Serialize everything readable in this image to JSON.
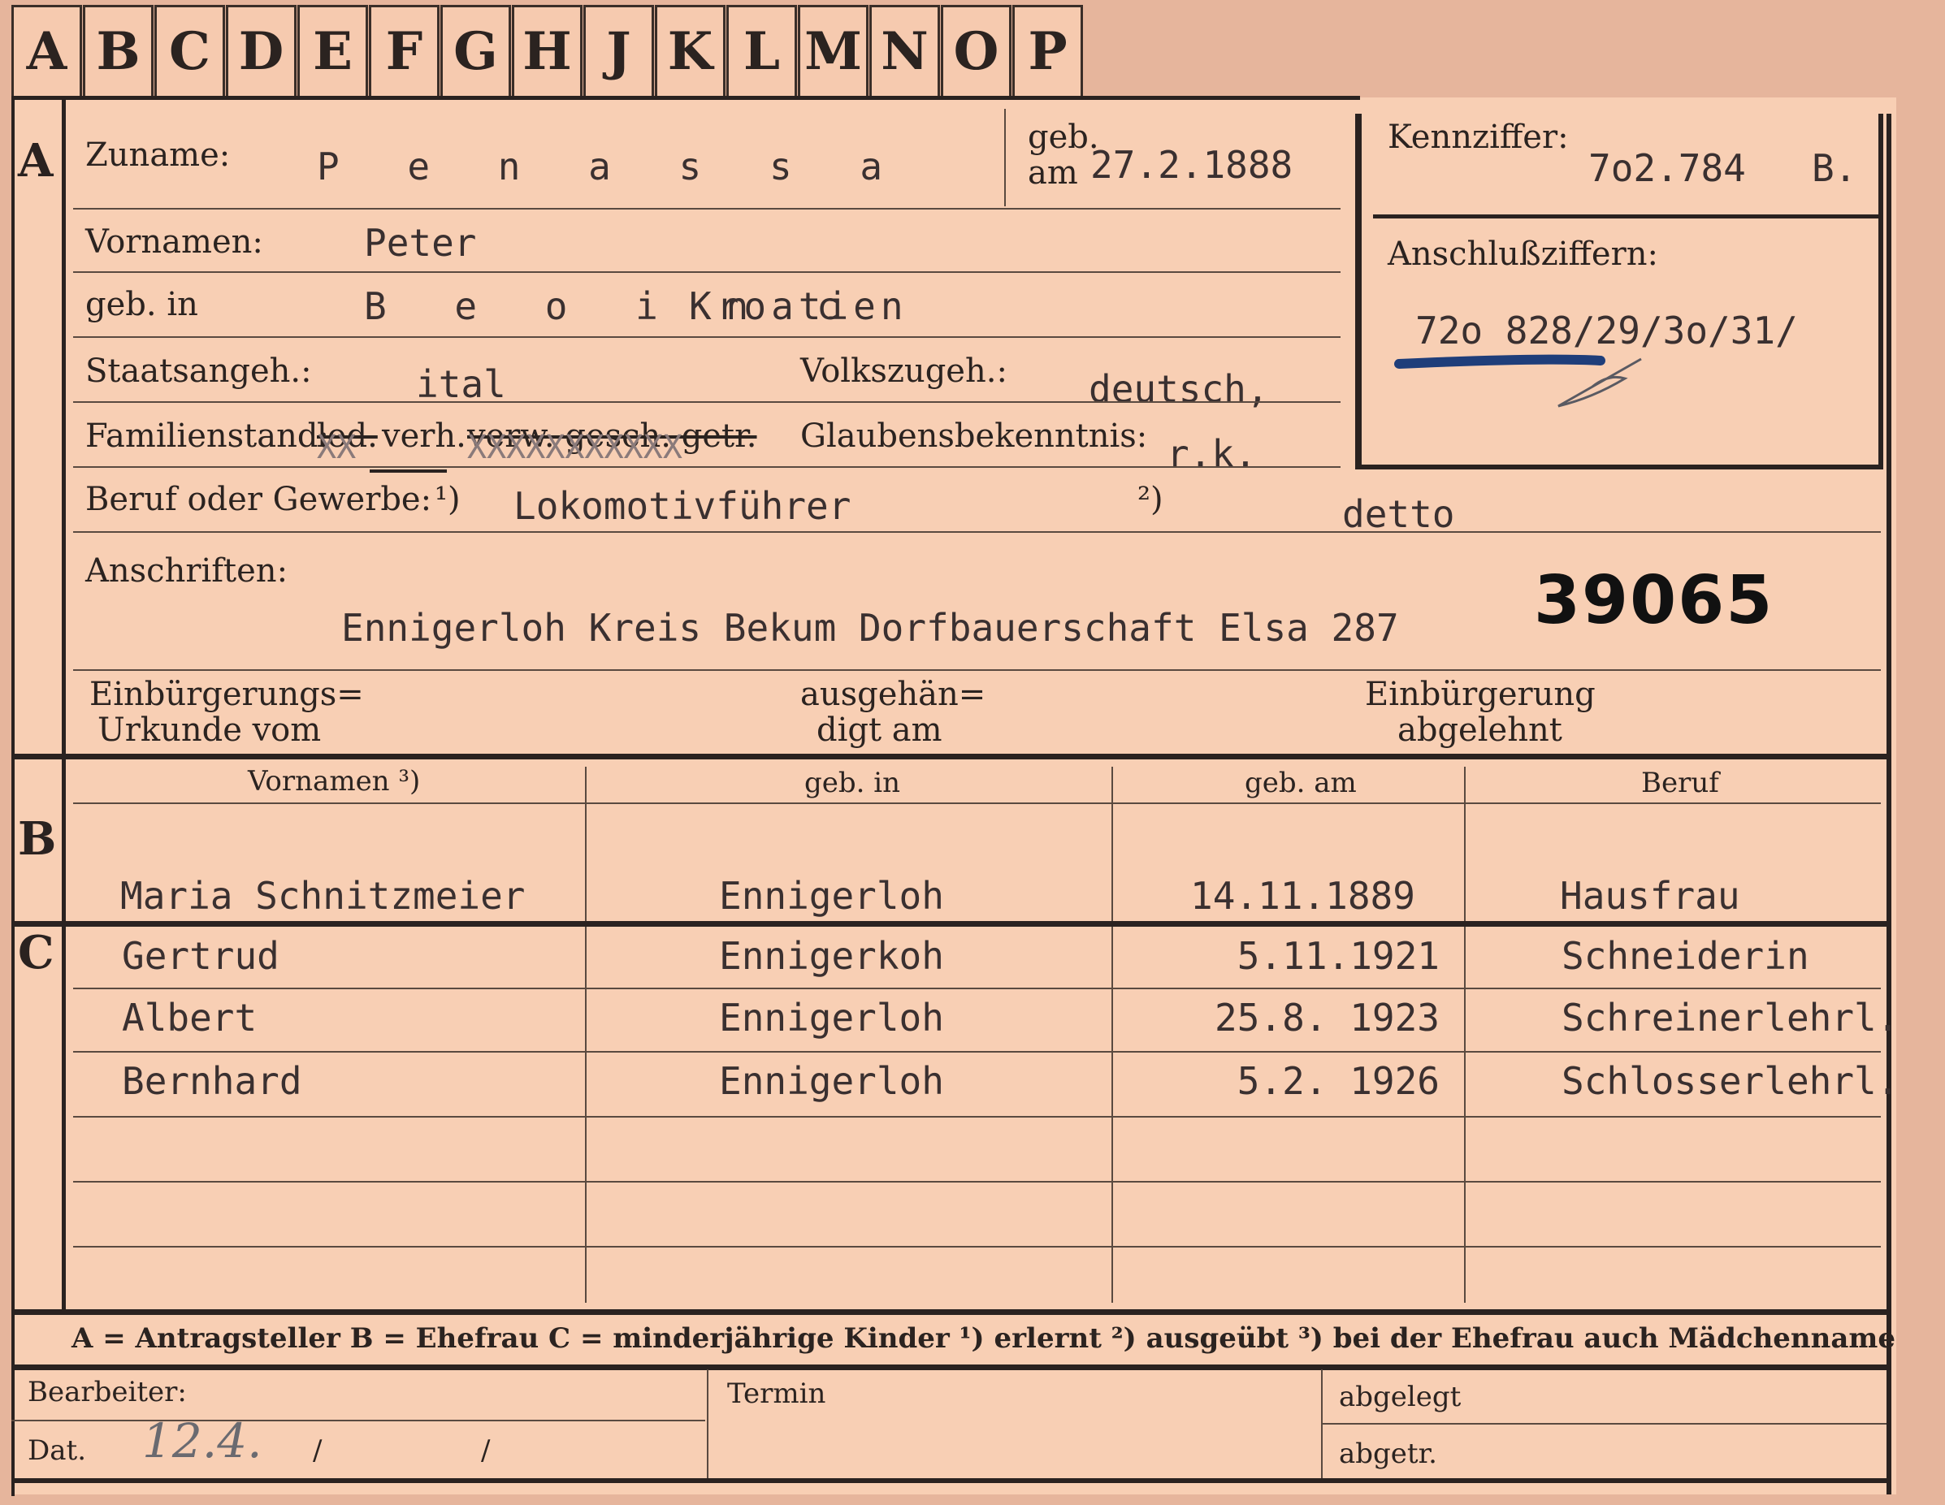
{
  "tabs": [
    "A",
    "B",
    "C",
    "D",
    "E",
    "F",
    "G",
    "H",
    "J",
    "K",
    "L",
    "M",
    "N",
    "O",
    "P"
  ],
  "section_a": {
    "marker": "A",
    "surname_label": "Zuname:",
    "surname": "P e n a s s a",
    "born_on_label_1": "geb.",
    "born_on_label_2": "am",
    "born_on": "27.2.1888",
    "given_names_label": "Vornamen:",
    "given_names": "Peter",
    "born_in_label": "geb. in",
    "born_in_place": "B e o i n c",
    "born_in_country": "Kroatien",
    "citizenship_label": "Staatsangeh.:",
    "citizenship": "ital",
    "ethnicity_label": "Volkszugeh.:",
    "ethnicity": "deutsch,",
    "marital_label": "Familienstand:",
    "marital_led": "led.",
    "marital_verh": "verh.",
    "marital_rest": "verw. gesch. getr.",
    "marital_xs": "XX",
    "marital_xs2": "XXXXXXXXXXX",
    "religion_label": "Glaubensbekenntnis:",
    "religion": "r.k.",
    "occupation_label": "Beruf oder Gewerbe:",
    "occupation_mark_1": "¹)",
    "occupation_learned": "Lokomotivführer",
    "occupation_mark_2": "²)",
    "occupation_practiced": "detto",
    "address_label": "Anschriften:",
    "address": "Ennigerloh Kreis Bekum Dorfbauerschaft Elsa 287",
    "stamp_number": "39065",
    "naturalization_label_1": "Einbürgerungs=",
    "naturalization_label_2": "Urkunde vom",
    "handed_label_1": "ausgehän=",
    "handed_label_2": "digt am",
    "rejected_label_1": "Einbürgerung",
    "rejected_label_2": "abgelehnt"
  },
  "id_box": {
    "code_label": "Kennziffer:",
    "code": "7o2.784",
    "code_suffix": "B.",
    "connection_label": "Anschlußziffern:",
    "connection": "72o 828/29/3o/31/"
  },
  "columns": {
    "given_names": "Vornamen ³)",
    "born_in": "geb. in",
    "born_on": "geb. am",
    "occupation": "Beruf"
  },
  "section_b": {
    "marker": "B",
    "wife": {
      "name": "Maria Schnitzmeier",
      "born_in": "Ennigerloh",
      "born_on": "14.11.1889",
      "occupation": "Hausfrau"
    }
  },
  "section_c": {
    "marker": "C",
    "children": [
      {
        "name": "Gertrud",
        "born_in": "Ennigerkoh",
        "born_on": "5.11.1921",
        "occupation": "Schneiderin"
      },
      {
        "name": "Albert",
        "born_in": "Ennigerloh",
        "born_on": "25.8. 1923",
        "occupation": "Schreinerlehrl."
      },
      {
        "name": "Bernhard",
        "born_in": "Ennigerloh",
        "born_on": "5.2. 1926",
        "occupation": "Schlosserlehrl."
      }
    ]
  },
  "legend": "A = Antragsteller   B = Ehefrau   C = minderjährige Kinder   ¹) erlernt   ²) ausgeübt   ³) bei der Ehefrau auch Mädchenname",
  "footer": {
    "clerk_label": "Bearbeiter:",
    "date_label": "Dat.",
    "date_value": "12.4.",
    "slash_1": "/",
    "slash_2": "/",
    "deadline_label": "Termin",
    "filed_label": "abgelegt",
    "issued_label": "abgetr."
  }
}
